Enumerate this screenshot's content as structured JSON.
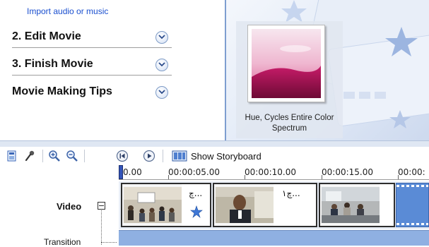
{
  "task_pane": {
    "import_link": "Import audio or music",
    "tasks": [
      {
        "label": "2. Edit Movie"
      },
      {
        "label": "3. Finish Movie"
      },
      {
        "label": "Movie Making Tips"
      }
    ]
  },
  "preview_pane": {
    "effect_caption": "Hue, Cycles Entire Color Spectrum"
  },
  "toolbar": {
    "show_storyboard_label": "Show Storyboard"
  },
  "timeline": {
    "ruler": [
      "0.00",
      "00:00:05.00",
      "00:00:10.00",
      "00:00:15.00",
      "00:00:"
    ],
    "tracks": {
      "video": "Video",
      "transition": "Transition"
    },
    "clips": [
      {
        "label": "چ..."
      },
      {
        "label": "چ١..."
      },
      {
        "label": ""
      }
    ]
  },
  "colors": {
    "accent": "#1a4fcf",
    "transition_track": "#8fb0e2",
    "clip_blue": "#5a8bd6"
  },
  "icons": {
    "toolbar": [
      "storyboard-timeline-icon",
      "narrate-icon",
      "zoom-in-icon",
      "zoom-out-icon",
      "rewind-icon",
      "play-icon",
      "storyboard-icon"
    ],
    "task_expand": "chevron-down-icon",
    "clip_effect": "star-effect-icon"
  }
}
